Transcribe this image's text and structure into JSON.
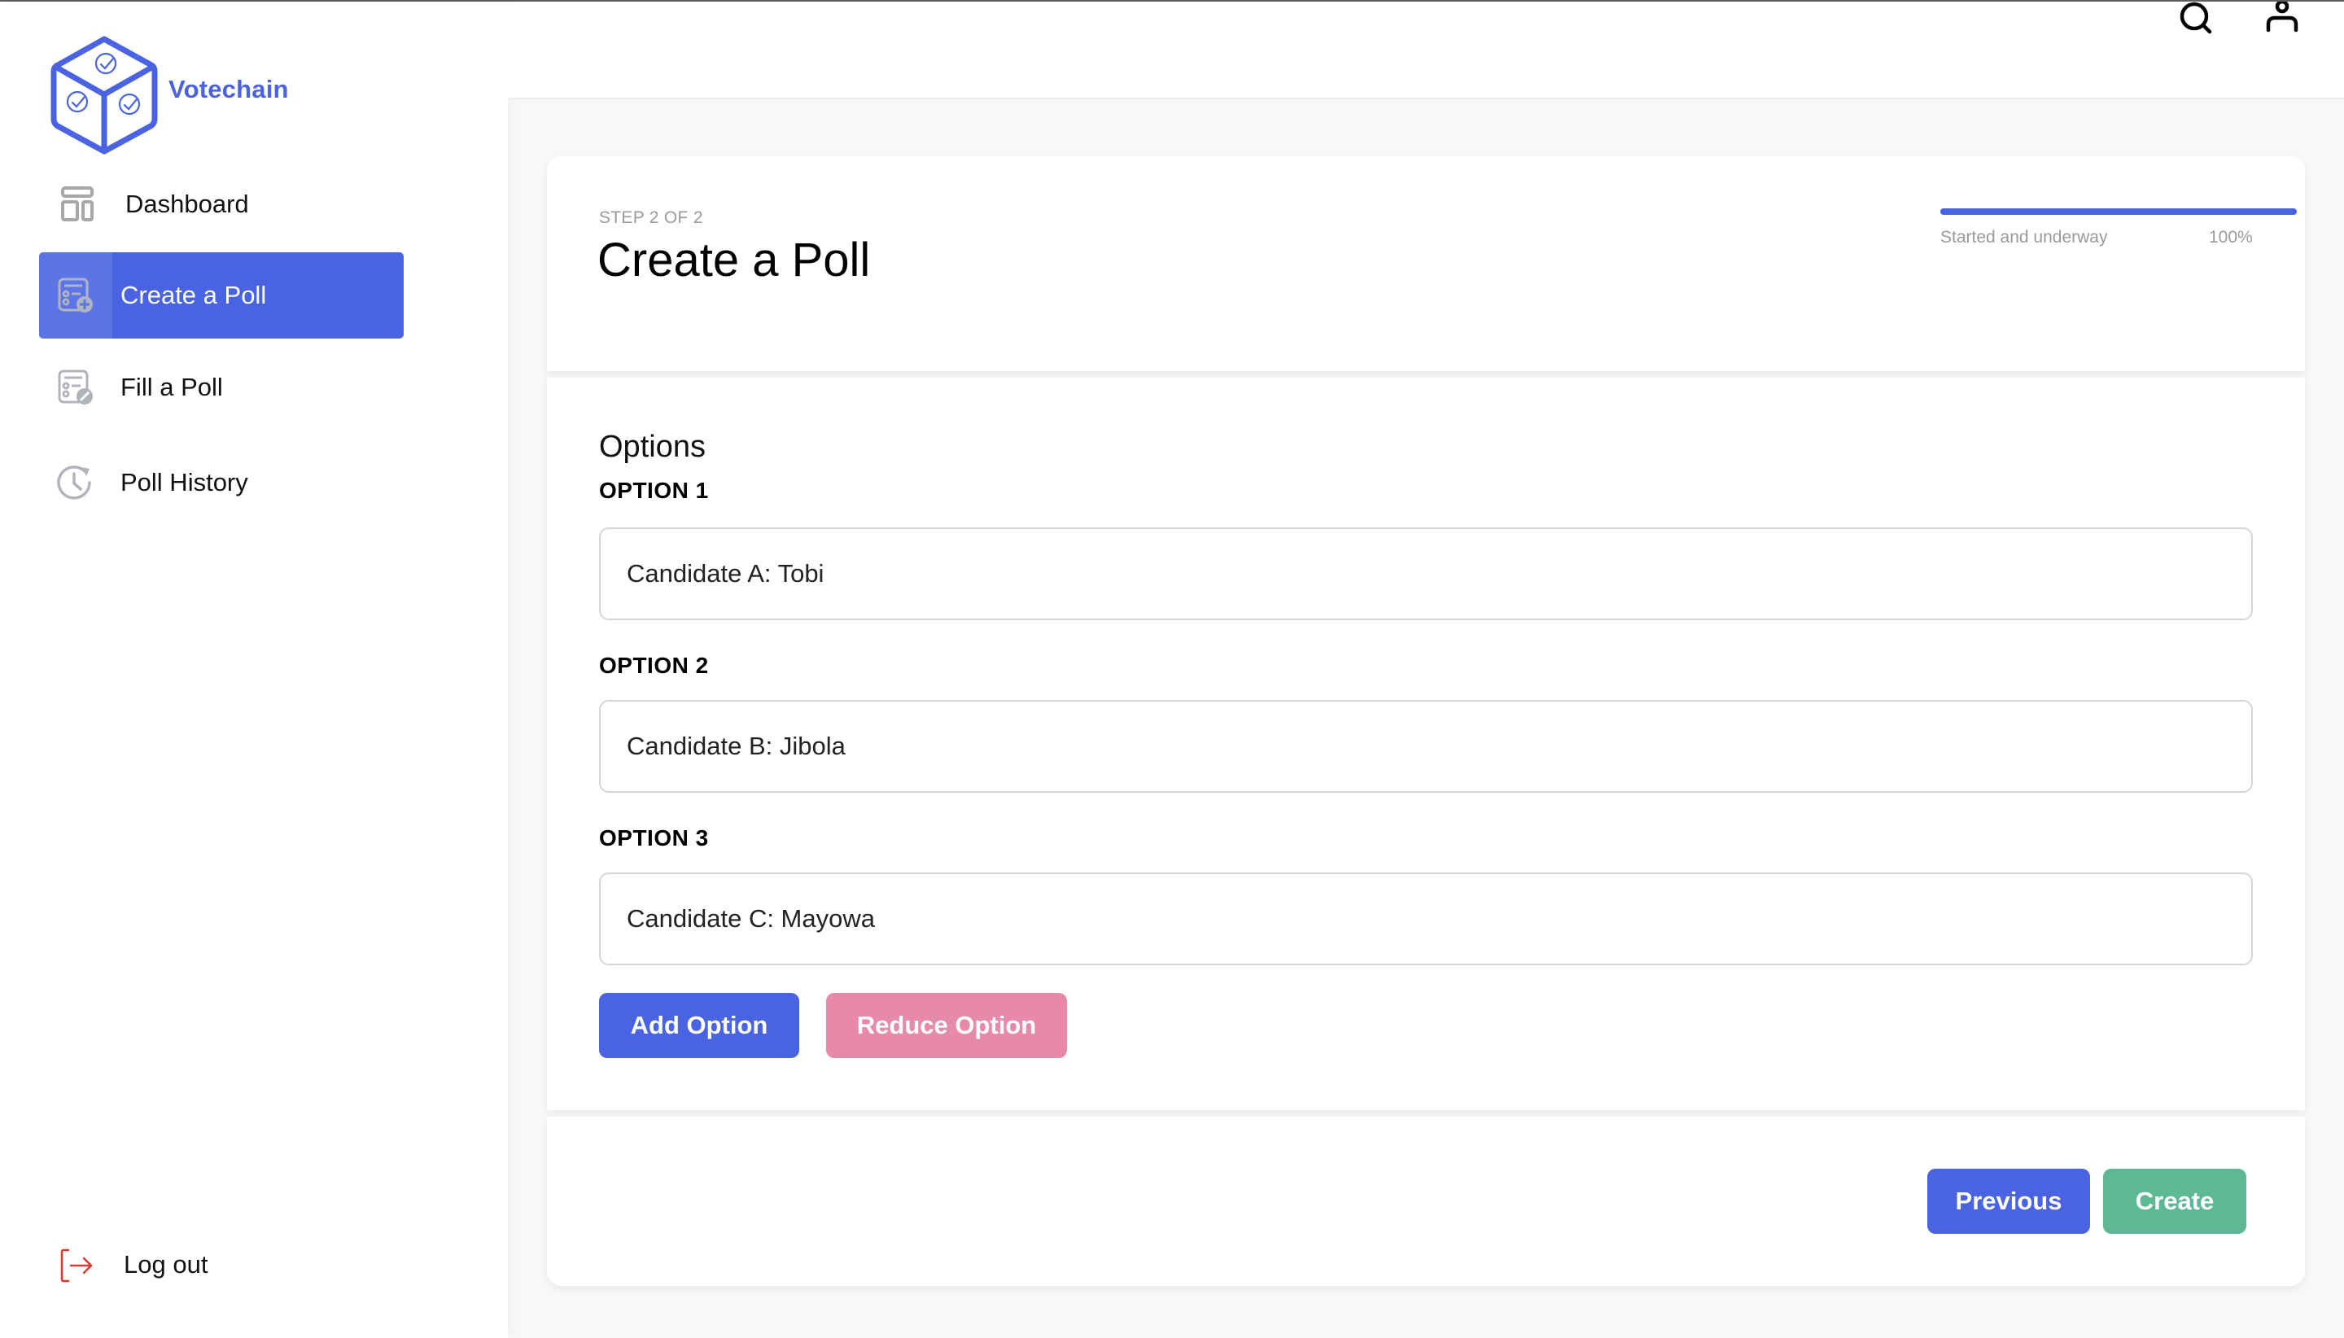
{
  "app": {
    "brand_name": "Votechain",
    "accent_color": "#4a63e2"
  },
  "sidebar": {
    "items": [
      {
        "label": "Dashboard",
        "icon": "dashboard-layout-icon",
        "active": false
      },
      {
        "label": "Create a Poll",
        "icon": "create-poll-icon",
        "active": true
      },
      {
        "label": "Fill a Poll",
        "icon": "fill-poll-icon",
        "active": false
      },
      {
        "label": "Poll History",
        "icon": "history-clock-icon",
        "active": false
      }
    ],
    "logout_label": "Log out"
  },
  "header": {
    "icons": [
      "search-icon",
      "user-icon"
    ]
  },
  "wizard": {
    "step_text": "STEP 2 OF 2",
    "title": "Create a Poll",
    "progress": {
      "label": "Started and underway",
      "percent_text": "100%",
      "value": 100
    }
  },
  "options_section": {
    "title": "Options",
    "options": [
      {
        "label": "OPTION 1",
        "value": "Candidate A: Tobi"
      },
      {
        "label": "OPTION 2",
        "value": "Candidate B: Jibola"
      },
      {
        "label": "OPTION 3",
        "value": "Candidate C: Mayowa"
      }
    ],
    "add_label": "Add Option",
    "reduce_label": "Reduce Option"
  },
  "footer": {
    "previous_label": "Previous",
    "create_label": "Create"
  },
  "colors": {
    "primary": "#4a63e2",
    "danger_soft": "#e68aa8",
    "success": "#5cb895",
    "logout_icon": "#e0382e"
  }
}
